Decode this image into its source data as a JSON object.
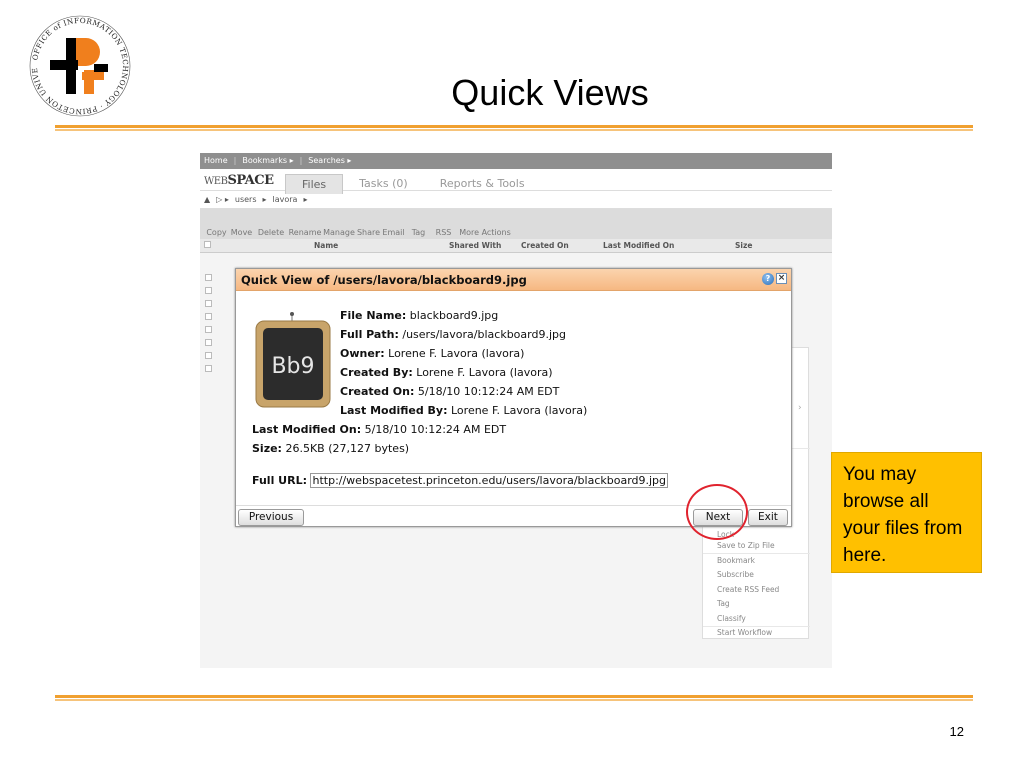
{
  "slide": {
    "title": "Quick Views",
    "page_number": "12",
    "logo": {
      "ring_text": "OFFICE of INFORMATION TECHNOLOGY · PRINCETON UNIVERSITY ·",
      "colors": {
        "orange": "#f07f1d",
        "black": "#000000"
      }
    },
    "accent_color": "#f0a030"
  },
  "app": {
    "nav": [
      "Home",
      "Bookmarks ▸",
      "Searches ▸"
    ],
    "brand": {
      "prefix": "WEB",
      "suffix": "SPACE"
    },
    "tabs": [
      {
        "label": "Files",
        "active": true
      },
      {
        "label": "Tasks (0)",
        "active": false
      },
      {
        "label": "Reports & Tools",
        "active": false
      }
    ],
    "path": [
      "users",
      "lavora"
    ],
    "toolbar": [
      "Copy",
      "Move",
      "Delete",
      "Rename",
      "Manage",
      "Share",
      "Email",
      "Tag",
      "RSS",
      "More Actions"
    ],
    "columns": [
      "Name",
      "Shared With",
      "Created On",
      "Last Modified On",
      "Size"
    ],
    "context_menu": [
      "Lock",
      "Save to Zip File",
      "Bookmark",
      "Subscribe",
      "Create RSS Feed",
      "Tag",
      "Classify",
      "Start Workflow"
    ]
  },
  "dialog": {
    "title": "Quick View of /users/lavora/blackboard9.jpg",
    "thumbnail_text": "Bb9",
    "fields": [
      {
        "key": "File Name:",
        "value": "blackboard9.jpg"
      },
      {
        "key": "Full Path:",
        "value": "/users/lavora/blackboard9.jpg"
      },
      {
        "key": "Owner:",
        "value": "Lorene F. Lavora (lavora)"
      },
      {
        "key": "Created By:",
        "value": "Lorene F. Lavora (lavora)"
      },
      {
        "key": "Created On:",
        "value": "5/18/10 10:12:24 AM EDT"
      },
      {
        "key": "Last Modified By:",
        "value": "Lorene F. Lavora (lavora)"
      },
      {
        "key": "Last Modified On:",
        "value": "5/18/10 10:12:24 AM EDT"
      },
      {
        "key": "Size:",
        "value": "26.5KB (27,127 bytes)"
      }
    ],
    "url": {
      "key": "Full URL:",
      "value": "http://webspacetest.princeton.edu/users/lavora/blackboard9.jpg"
    },
    "buttons": {
      "previous": "Previous",
      "next": "Next",
      "exit": "Exit"
    }
  },
  "callout": {
    "text": "You may browse all your files from here.",
    "color": "#ffc000",
    "highlight_color": "#e0232e"
  }
}
